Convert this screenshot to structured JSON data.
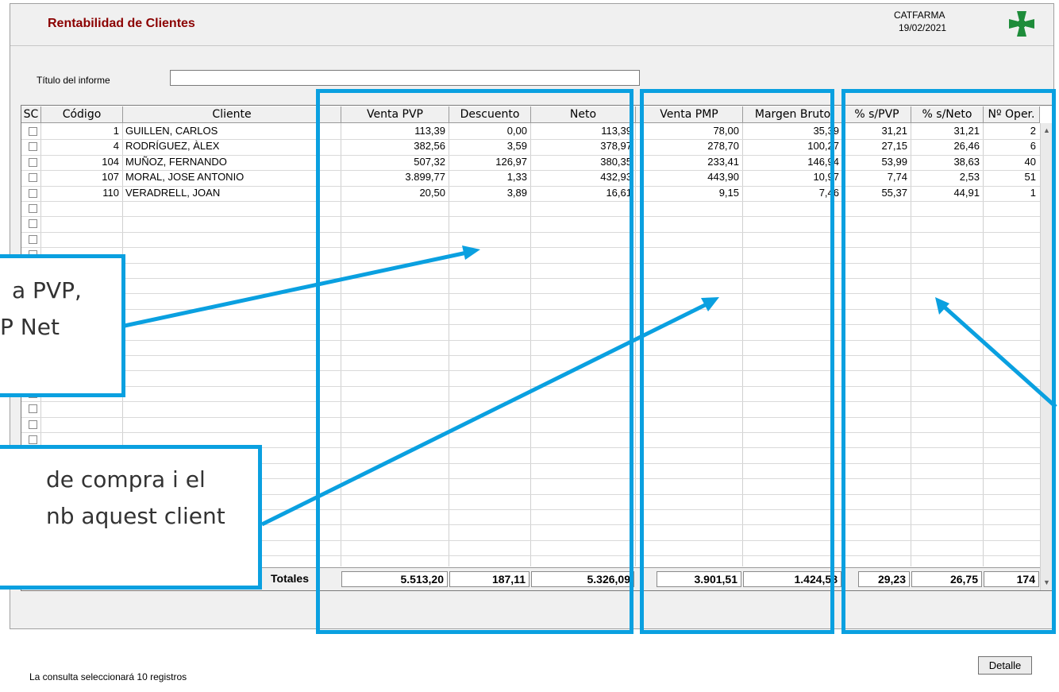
{
  "window": {
    "title": "Rentabilidad de Clientes",
    "company": "CATFARMA",
    "date": "19/02/2021"
  },
  "report_title": {
    "label": "Título del informe",
    "value": ""
  },
  "table": {
    "columns": [
      "SC",
      "Código",
      "Cliente",
      "Venta PVP",
      "Descuento",
      "Neto",
      "Venta PMP",
      "Margen Bruto",
      "% s/PVP",
      "% s/Neto",
      "Nº Oper."
    ],
    "rows": [
      {
        "codigo": "1",
        "cliente": "GUILLEN, CARLOS",
        "venta_pvp": "113,39",
        "descuento": "0,00",
        "neto": "113,39",
        "venta_pmp": "78,00",
        "margen_bruto": "35,39",
        "pct_pvp": "31,21",
        "pct_neto": "31,21",
        "n_oper": "2"
      },
      {
        "codigo": "4",
        "cliente": "RODRÍGUEZ, ÀLEX",
        "venta_pvp": "382,56",
        "descuento": "3,59",
        "neto": "378,97",
        "venta_pmp": "278,70",
        "margen_bruto": "100,27",
        "pct_pvp": "27,15",
        "pct_neto": "26,46",
        "n_oper": "6"
      },
      {
        "codigo": "104",
        "cliente": "MUÑOZ, FERNANDO",
        "venta_pvp": "507,32",
        "descuento": "126,97",
        "neto": "380,35",
        "venta_pmp": "233,41",
        "margen_bruto": "146,94",
        "pct_pvp": "53,99",
        "pct_neto": "38,63",
        "n_oper": "40"
      },
      {
        "codigo": "107",
        "cliente": "MORAL, JOSE ANTONIO",
        "venta_pvp": "3.899,77",
        "descuento": "1,33",
        "neto": "432,93",
        "venta_pmp": "443,90",
        "margen_bruto": "10,97",
        "pct_pvp": "7,74",
        "pct_neto": "2,53",
        "n_oper": "51"
      },
      {
        "codigo": "110",
        "cliente": "VERADRELL, JOAN",
        "venta_pvp": "20,50",
        "descuento": "3,89",
        "neto": "16,61",
        "venta_pmp": "9,15",
        "margen_bruto": "7,46",
        "pct_pvp": "55,37",
        "pct_neto": "44,91",
        "n_oper": "1"
      }
    ],
    "totals_label": "Totales",
    "totals": {
      "venta_pvp": "5.513,20",
      "descuento": "187,11",
      "neto": "5.326,09",
      "venta_pmp": "3.901,51",
      "margen_bruto": "1.424,58",
      "pct_pvp": "29,23",
      "pct_neto": "26,75",
      "n_oper": "174"
    }
  },
  "status_text": "La consulta seleccionará 10  registros",
  "detalle_button": "Detalle",
  "callouts": [
    {
      "lines": [
        "a PVP,",
        "P   Net"
      ]
    },
    {
      "lines": [
        "de compra i el",
        "nb aquest client"
      ]
    }
  ],
  "colors": {
    "title": "#8b0000",
    "highlight": "#0aa0e0",
    "logo": "#1e8c3a"
  }
}
